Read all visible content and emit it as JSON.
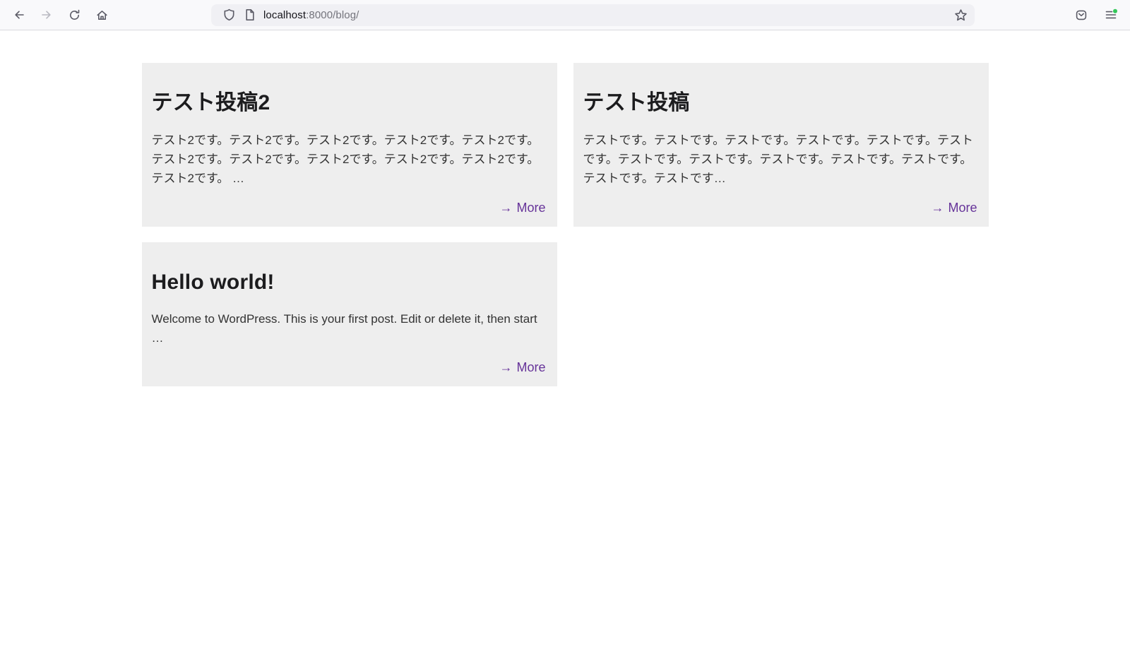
{
  "browser": {
    "toolbar": {
      "url_host": "localhost",
      "url_path": ":8000/blog/",
      "icon_names": {
        "back": "back-arrow",
        "forward": "forward-arrow",
        "reload": "reload-circular-arrow",
        "home": "home-house",
        "shield": "tracking-protection-shield",
        "page": "page-document",
        "star": "bookmark-star",
        "pocket": "save-to-pocket",
        "menu": "hamburger-menu"
      },
      "menu_badge_color": "#34c759"
    }
  },
  "page": {
    "accent_color": "#663399",
    "card_background": "#eeeeee",
    "posts": [
      {
        "title": "テスト投稿2",
        "excerpt": "テスト2です。テスト2です。テスト2です。テスト2です。テスト2です。テスト2です。テスト2です。テスト2です。テスト2です。テスト2です。テスト2です。 …",
        "more_arrow": "→",
        "more_label": "More"
      },
      {
        "title": "テスト投稿",
        "excerpt": "テストです。テストです。テストです。テストです。テストです。テストです。テストです。テストです。テストです。テストです。テストです。テストです。テストです…",
        "more_arrow": "→",
        "more_label": "More"
      },
      {
        "title": "Hello world!",
        "excerpt": "Welcome to WordPress. This is your first post. Edit or delete it, then start …",
        "more_arrow": "→",
        "more_label": "More"
      }
    ]
  }
}
